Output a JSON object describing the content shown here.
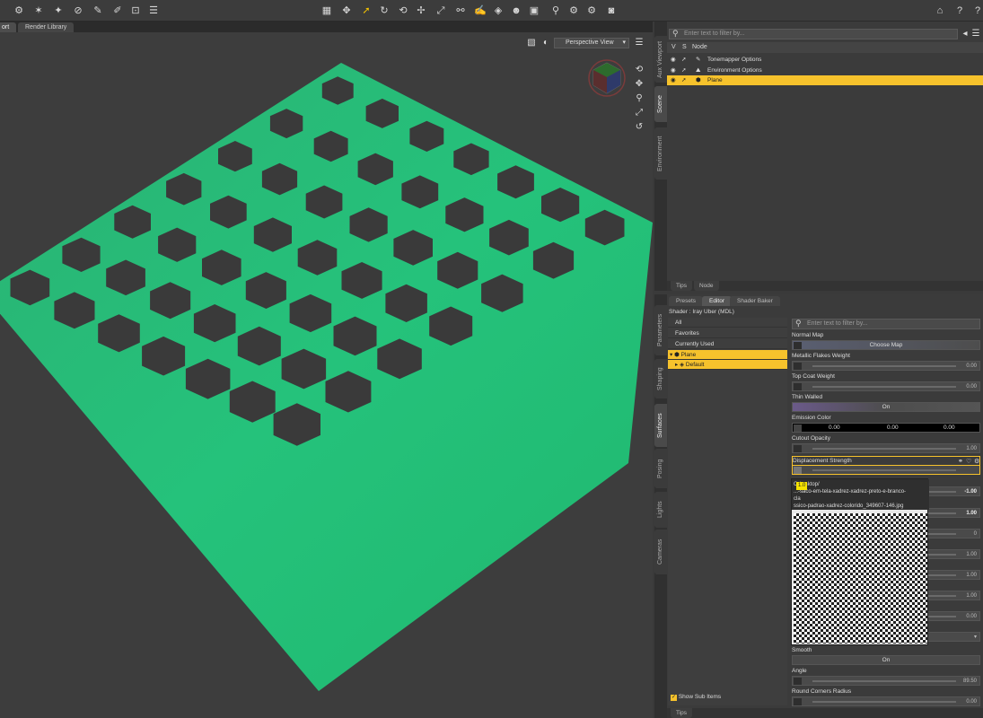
{
  "viewport": {
    "tabs": [
      "ort",
      "Render Library"
    ],
    "view_select": "Perspective View"
  },
  "scene": {
    "filter_placeholder": "Enter text to filter by...",
    "header": {
      "v": "V",
      "s": "S",
      "node": "Node"
    },
    "rows": [
      {
        "label": "Tonemapper Options",
        "selected": false
      },
      {
        "label": "Environment Options",
        "selected": false
      },
      {
        "label": "Plane",
        "selected": true
      }
    ],
    "side_tabs": [
      "Aux Viewport",
      "Scene",
      "Environment"
    ],
    "bottom_tabs": [
      "Tips",
      "Node"
    ]
  },
  "surfaces": {
    "top_tabs": [
      "Presets",
      "Editor",
      "Shader Baker"
    ],
    "shader_label": "Shader : Iray Uber (MDL)",
    "filter_placeholder": "Enter text to filter by...",
    "tree": [
      {
        "label": "All",
        "selected": false
      },
      {
        "label": "Favorites",
        "selected": false
      },
      {
        "label": "Currently Used",
        "selected": false
      },
      {
        "label": "Plane",
        "selected": true
      },
      {
        "label": "Default",
        "selected": true
      }
    ],
    "show_sub_items": "Show Sub Items",
    "side_tabs": [
      "Parameters",
      "Shaping",
      "Surfaces",
      "Posing",
      "Lights",
      "Cameras"
    ],
    "bottom_tab": "Tips",
    "props": [
      {
        "label": "Normal Map",
        "kind": "map",
        "value": "Choose Map"
      },
      {
        "label": "Metallic Flakes Weight",
        "kind": "slider",
        "value": "0.00"
      },
      {
        "label": "Top Coat Weight",
        "kind": "slider",
        "value": "0.00"
      },
      {
        "label": "Thin Walled",
        "kind": "toggle",
        "value": "On"
      },
      {
        "label": "Emission Color",
        "kind": "color",
        "values": [
          "0.00",
          "0.00",
          "0.00"
        ]
      },
      {
        "label": "Cutout Opacity",
        "kind": "slider",
        "value": "1.00"
      },
      {
        "label": "Displacement Strength",
        "kind": "slider",
        "value": "",
        "highlight": true
      }
    ],
    "popup": {
      "path_lines": [
        "C:/...sktop/",
        "...-saco-em-tela-xadrez-xadrez-preto-e-branco-",
        "cla",
        "ssico-padrao-xadrez-colorido_349607-146.jpg"
      ],
      "tag": "1.0"
    },
    "hidden_values": [
      "-1.00",
      "1.00",
      "0",
      "1.00",
      "1.00",
      "1.00",
      "0.00"
    ],
    "props_lower": [
      {
        "label": "Smooth",
        "kind": "toggle",
        "value": "On"
      },
      {
        "label": "Angle",
        "kind": "slider",
        "value": "89.50"
      },
      {
        "label": "Round Corners Radius",
        "kind": "slider",
        "value": "0.00"
      }
    ]
  }
}
